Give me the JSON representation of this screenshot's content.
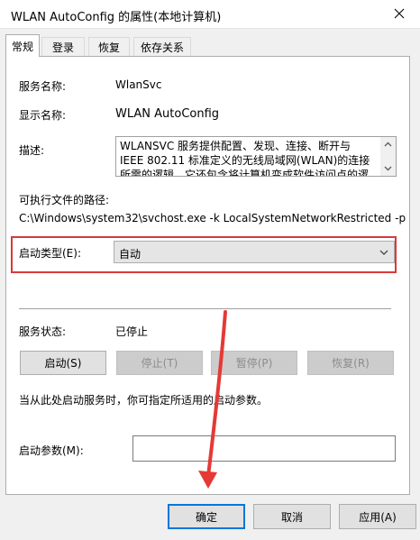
{
  "window": {
    "title": "WLAN AutoConfig 的属性(本地计算机)"
  },
  "tabs": [
    {
      "label": "常规",
      "active": true
    },
    {
      "label": "登录"
    },
    {
      "label": "恢复"
    },
    {
      "label": "依存关系"
    }
  ],
  "general": {
    "service_name_label": "服务名称:",
    "service_name_value": "WlanSvc",
    "display_name_label": "显示名称:",
    "display_name_value": "WLAN AutoConfig",
    "description_label": "描述:",
    "description_value": "WLANSVC 服务提供配置、发现、连接、断开与 IEEE 802.11 标准定义的无线局域网(WLAN)的连接所需的逻辑。它还包含将计算机变成软件访问点的逻辑，以便",
    "exe_path_label": "可执行文件的路径:",
    "exe_path_value": "C:\\Windows\\system32\\svchost.exe -k LocalSystemNetworkRestricted -p",
    "startup_type_label": "启动类型(E):",
    "startup_type_value": "自动",
    "status_label": "服务状态:",
    "status_value": "已停止",
    "buttons": {
      "start": "启动(S)",
      "stop": "停止(T)",
      "pause": "暂停(P)",
      "resume": "恢复(R)"
    },
    "hint": "当从此处启动服务时，你可指定所适用的启动参数。",
    "params_label": "启动参数(M):",
    "params_value": ""
  },
  "footer": {
    "ok": "确定",
    "cancel": "取消",
    "apply": "应用(A)"
  },
  "colors": {
    "highlight_border": "#d8393b",
    "annotation_arrow": "#e53935",
    "focus_border": "#0078d7"
  }
}
